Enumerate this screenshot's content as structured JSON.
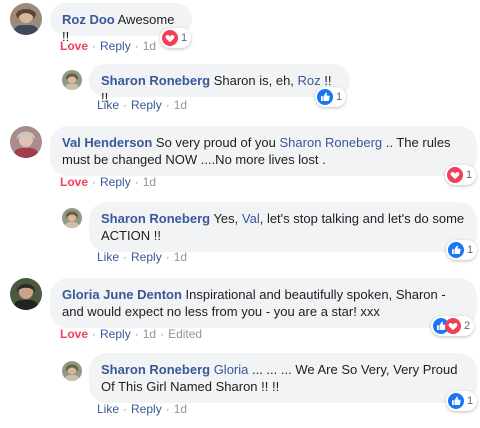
{
  "colors": {
    "link": "#385898",
    "love": "#f33e58",
    "like_blue": "#1877f2",
    "bubble": "#f2f3f5",
    "meta": "#90949c"
  },
  "labels": {
    "love": "Love",
    "like": "Like",
    "reply": "Reply",
    "sep": "·",
    "edited": "Edited"
  },
  "comments": [
    {
      "name": "Roz Doo",
      "text": " Awesome !!",
      "age": "1d",
      "reaction": "heart-icon",
      "count": "1"
    },
    {
      "name": "Sharon Roneberg",
      "text_pre": " Sharon is, eh, ",
      "mention": "Roz",
      "text_post": " !! !!",
      "age": "1d",
      "reaction": "like-icon",
      "count": "1"
    },
    {
      "name": "Val Henderson",
      "text_pre": " So very proud of you ",
      "mention": "Sharon Roneberg",
      "text_post": " .. The rules must be changed NOW ....No more lives lost .",
      "age": "1d",
      "reaction": "heart-icon",
      "count": "1"
    },
    {
      "name": "Sharon Roneberg",
      "text_pre": " Yes, ",
      "mention": "Val",
      "text_post": ", let's stop talking and let's do some ACTION !!",
      "age": "1d",
      "reaction": "like-icon",
      "count": "1"
    },
    {
      "name": "Gloria June Denton",
      "text": " Inspirational and beautifully spoken, Sharon - and would expect no less from you - you are a star! xxx",
      "age": "1d",
      "reaction": "like-heart-icons",
      "count": "2"
    },
    {
      "name": "Sharon Roneberg",
      "mention": " Gloria",
      "text_post": " ... ... ... We Are So Very, Very Proud Of This Girl Named Sharon !! !!",
      "age": "1d",
      "reaction": "like-icon",
      "count": "1"
    }
  ]
}
